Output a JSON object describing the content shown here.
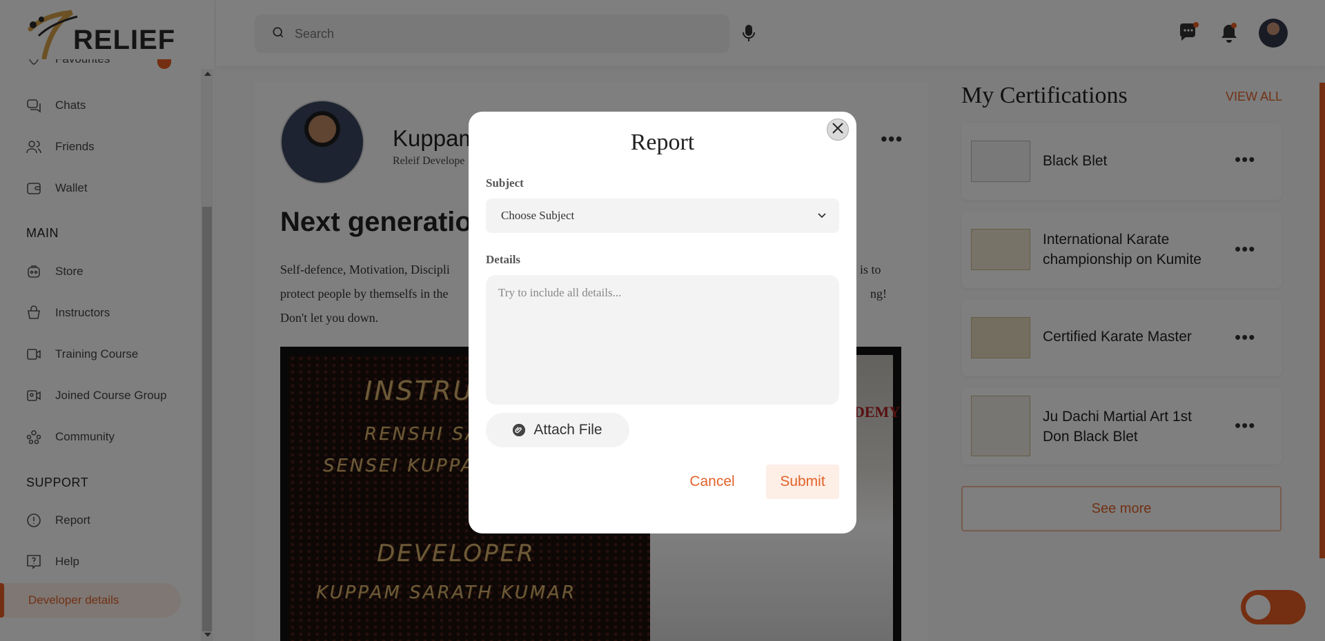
{
  "brand": {
    "name": "RELIEF",
    "accent": "#e85d22"
  },
  "sidebar": {
    "items_top": [
      {
        "label": "Favourites",
        "icon": "heart-icon"
      },
      {
        "label": "Chats",
        "icon": "chat-icon"
      },
      {
        "label": "Friends",
        "icon": "friends-icon"
      },
      {
        "label": "Wallet",
        "icon": "wallet-icon"
      }
    ],
    "main_label": "MAIN",
    "main_items": [
      {
        "label": "Store",
        "icon": "store-icon"
      },
      {
        "label": "Instructors",
        "icon": "instructors-icon"
      },
      {
        "label": "Training Course",
        "icon": "video-icon"
      },
      {
        "label": "Joined Course Group",
        "icon": "video-group-icon"
      },
      {
        "label": "Community",
        "icon": "community-icon"
      }
    ],
    "support_label": "SUPPORT",
    "support_items": [
      {
        "label": "Report",
        "icon": "alert-circle-icon"
      },
      {
        "label": "Help",
        "icon": "help-icon"
      }
    ],
    "active_item": "Developer details"
  },
  "header": {
    "search_placeholder": "Search",
    "icons": [
      "mic-icon",
      "messages-icon",
      "bell-icon",
      "avatar"
    ]
  },
  "post": {
    "author_name": "Kuppam",
    "author_subtitle": "Releif Develope",
    "title": "Next generatio",
    "body_lines": [
      "Self-defence, Motivation, Discipli",
      "protect people by themselfs in the",
      "Don't let you down."
    ],
    "body_right": [
      "is to",
      "ng!"
    ],
    "image_text": {
      "instructor": "INSTRUC",
      "renshi": "RENSHI SA",
      "sensei": "SENSEI KUPPA",
      "developer": "DEVELOPER",
      "developer_name": "KUPPAM SARATH KUMAR",
      "academy": "DEMY"
    }
  },
  "certifications": {
    "heading": "My Certifications",
    "view_all": "VIEW ALL",
    "items": [
      {
        "title": "Black Blet"
      },
      {
        "title": "International Karate championship on Kumite"
      },
      {
        "title": "Certified Karate Master"
      },
      {
        "title": "Ju Dachi Martial Art 1st Don Black Blet"
      }
    ],
    "see_more": "See more"
  },
  "modal": {
    "title": "Report",
    "subject_label": "Subject",
    "subject_value": "Choose Subject",
    "details_label": "Details",
    "details_placeholder": "Try to include all details...",
    "attach_label": "Attach File",
    "cancel_label": "Cancel",
    "submit_label": "Submit"
  }
}
